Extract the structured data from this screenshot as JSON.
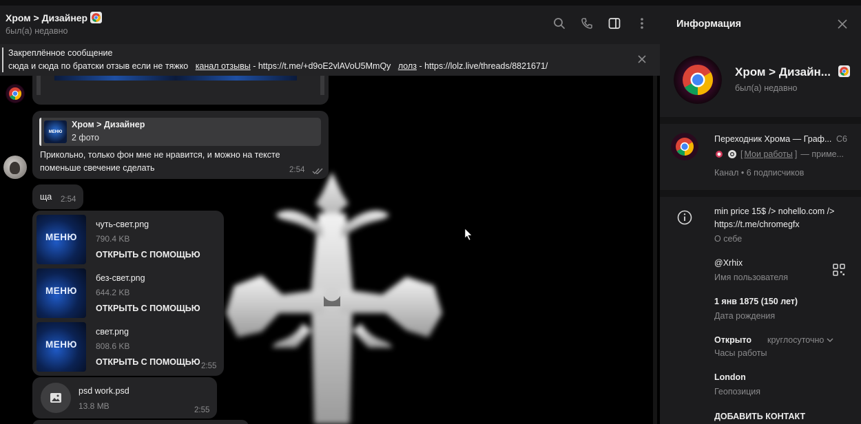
{
  "chat": {
    "title": "Хром > Дизайнер",
    "status": "был(а) недавно"
  },
  "pinned": {
    "title": "Закреплённое сообщение",
    "text_prefix": "сюда и сюда по братски отзыв если не тяжко",
    "link1_label": "канал отзывы",
    "link1_url": " - https://t.me/+d9oE2vlAVoU5MmQy",
    "link2_label": "лолз",
    "link2_url": " - https://lolz.live/threads/8821671/"
  },
  "messages": {
    "reply_author": "Хром > Дизайнер",
    "reply_desc": "2 фото",
    "reply_text_line1": "Прикольно, только фон мне не нравится, и можно на тексте",
    "reply_text_line2": "поменьше свечение сделать",
    "reply_time": "2:54",
    "sha_text": "ща",
    "sha_time": "2:54",
    "files": [
      {
        "name": "чуть-свет.png",
        "size": "790.4 KB",
        "action": "ОТКРЫТЬ С ПОМОЩЬЮ",
        "thumb_text": "МЕНЮ"
      },
      {
        "name": "без-свет.png",
        "size": "644.2 KB",
        "action": "ОТКРЫТЬ С ПОМОЩЬЮ",
        "thumb_text": "МЕНЮ"
      },
      {
        "name": "свет.png",
        "size": "808.6 KB",
        "action": "ОТКРЫТЬ С ПОМОЩЬЮ",
        "thumb_text": "МЕНЮ"
      }
    ],
    "files_time": "2:55",
    "psd_name": "psd work.psd",
    "psd_size": "13.8 MB",
    "psd_time": "2:55"
  },
  "info": {
    "title": "Информация",
    "name": "Хром > Дизайн...",
    "status": "был(а) недавно",
    "channel_name": "Переходник Хрома — Граф...",
    "channel_count": "С6",
    "channel_desc_link": "Мои работы",
    "channel_desc_rest": "— приме...",
    "channel_sub": "Канал • 6 подписчиков",
    "bio_line1": "min price 15$ /> nohello.com />",
    "bio_line2": "https://t.me/chromegfx",
    "bio_label": "О себе",
    "username": "@Xrhix",
    "username_label": "Имя пользователя",
    "birthday": "1 янв 1875 (150 лет)",
    "birthday_label": "Дата рождения",
    "hours_status": "Открыто",
    "hours_value": "круглосуточно",
    "hours_label": "Часы работы",
    "location": "London",
    "location_label": "Геопозиция",
    "add_contact": "ДОБАВИТЬ КОНТАКТ"
  },
  "colors": {
    "bubble": "#242426",
    "panel": "#1c1c1e",
    "chat_bg": "#000000",
    "accent_blue": "#3a7bd5"
  }
}
